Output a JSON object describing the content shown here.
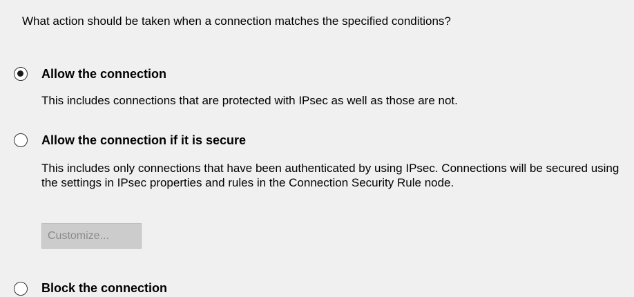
{
  "question": "What action should be taken when a connection matches the specified conditions?",
  "options": [
    {
      "label": "Allow the connection",
      "description": "This includes connections that are protected with IPsec as well as those are not.",
      "selected": true
    },
    {
      "label": "Allow the connection if it is secure",
      "description": "This includes only connections that have been authenticated by using IPsec.  Connections will be secured using the settings in IPsec properties and rules in the Connection Security Rule node.",
      "selected": false
    },
    {
      "label": "Block the connection",
      "selected": false
    }
  ],
  "customize_button": {
    "label": "Customize...",
    "enabled": false
  }
}
